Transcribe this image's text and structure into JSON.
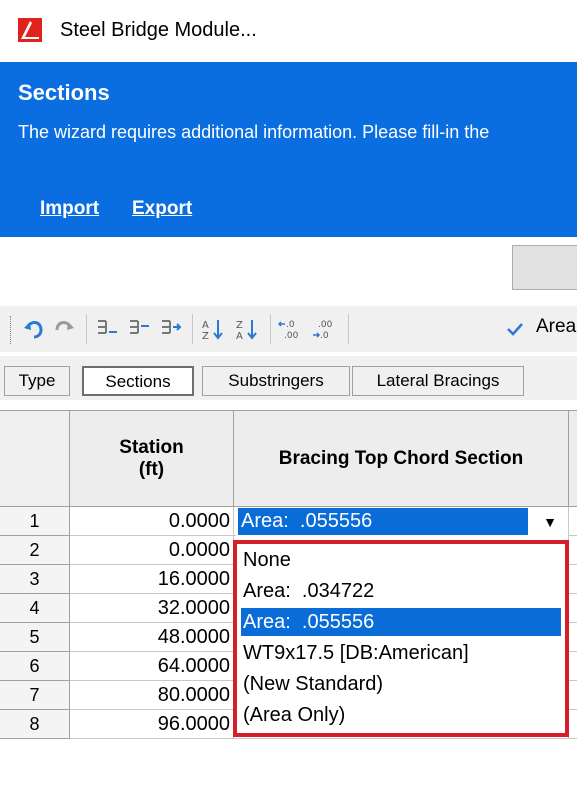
{
  "window": {
    "title": "Steel Bridge Module..."
  },
  "banner": {
    "heading": "Sections",
    "description": "The wizard requires additional information. Please fill-in the",
    "links": [
      "Import",
      "Export"
    ]
  },
  "toolbar": {
    "icons": [
      "undo-icon",
      "redo-icon",
      "insert-row-above-icon",
      "insert-row-below-icon",
      "append-row-icon",
      "sort-ascending-icon",
      "sort-descending-icon",
      "decrease-decimal-icon",
      "increase-decimal-icon",
      "check-icon"
    ],
    "field_label": "Area:"
  },
  "tabs": [
    {
      "label": "Type",
      "active": false
    },
    {
      "label": "Sections",
      "active": true
    },
    {
      "label": "Substringers",
      "active": false
    },
    {
      "label": "Lateral Bracings",
      "active": false
    }
  ],
  "grid": {
    "columns": [
      "Station\n(ft)",
      "Bracing Top Chord Section"
    ],
    "rows": [
      {
        "num": "1",
        "station": "0.0000",
        "bracing": "Area:  .055556"
      },
      {
        "num": "2",
        "station": "0.0000",
        "bracing": ""
      },
      {
        "num": "3",
        "station": "16.0000",
        "bracing": ""
      },
      {
        "num": "4",
        "station": "32.0000",
        "bracing": ""
      },
      {
        "num": "5",
        "station": "48.0000",
        "bracing": ""
      },
      {
        "num": "6",
        "station": "64.0000",
        "bracing": ""
      },
      {
        "num": "7",
        "station": "80.0000",
        "bracing": "WT9x17.5 [DB:American]"
      },
      {
        "num": "8",
        "station": "96.0000",
        "bracing": "WT9x17.5 [DB:American]"
      }
    ]
  },
  "dropdown": {
    "options": [
      "None",
      "Area:  .034722",
      "Area:  .055556",
      "WT9x17.5 [DB:American]",
      "(New Standard)",
      "(Area Only)"
    ],
    "selected_index": 2
  },
  "colors": {
    "accent": "#0b6ee0",
    "selection": "#0a6cd7",
    "highlight_border": "#d41e2a"
  }
}
